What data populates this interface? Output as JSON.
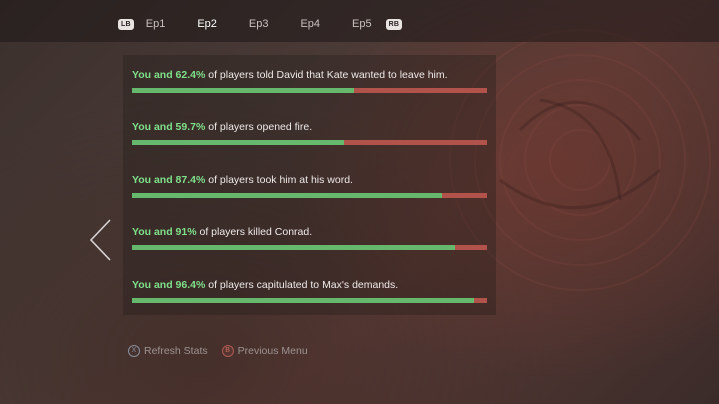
{
  "tabs": {
    "left_button": "LB",
    "right_button": "RB",
    "items": [
      {
        "label": "Ep1",
        "active": false
      },
      {
        "label": "Ep2",
        "active": true
      },
      {
        "label": "Ep3",
        "active": false
      },
      {
        "label": "Ep4",
        "active": false
      },
      {
        "label": "Ep5",
        "active": false
      }
    ]
  },
  "stats": [
    {
      "highlight": "You and 62.4%",
      "text": " of players told David that Kate wanted to leave him.",
      "percent": 62.4
    },
    {
      "highlight": "You and 59.7%",
      "text": " of players opened fire.",
      "percent": 59.7
    },
    {
      "highlight": "You and 87.4%",
      "text": " of players took him at his word.",
      "percent": 87.4
    },
    {
      "highlight": "You and 91%",
      "text": " of players killed Conrad.",
      "percent": 91
    },
    {
      "highlight": "You and 96.4%",
      "text": " of players capitulated to Max's demands.",
      "percent": 96.4
    }
  ],
  "footer": {
    "refresh": {
      "glyph": "X",
      "label": "Refresh Stats"
    },
    "previous": {
      "glyph": "B",
      "label": "Previous Menu"
    }
  },
  "colors": {
    "highlight": "#7fe08a",
    "bar_fill": "#66b86c",
    "bar_remainder": "#b1524b"
  },
  "icons": {
    "back": "chevron-left-icon"
  }
}
